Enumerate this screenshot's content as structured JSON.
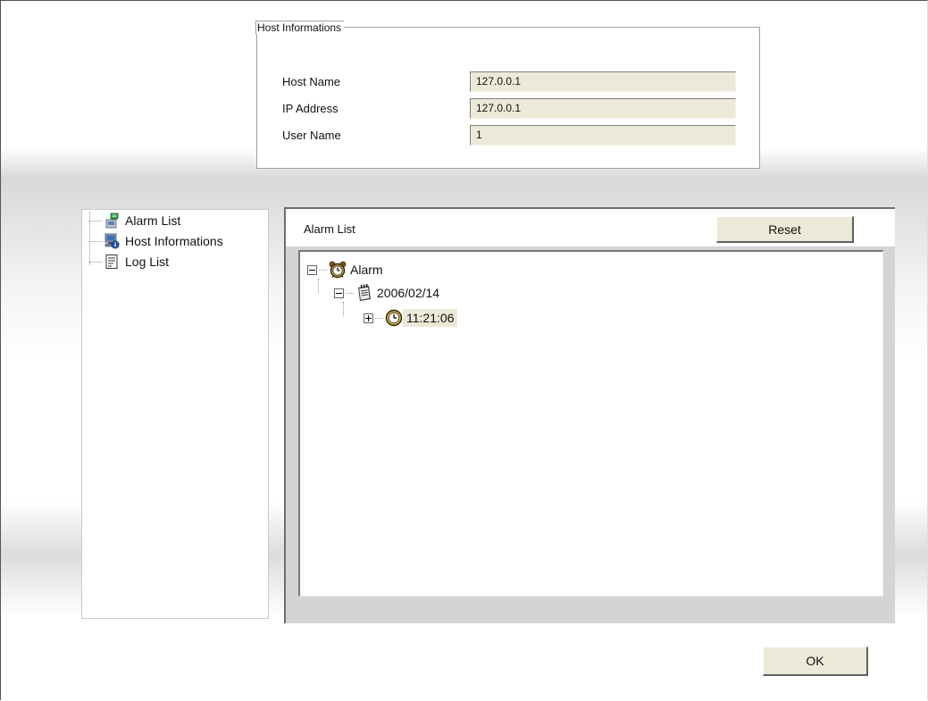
{
  "host_info": {
    "legend": "Host Informations",
    "rows": [
      {
        "label": "Host Name",
        "value": "127.0.0.1"
      },
      {
        "label": "IP Address",
        "value": "127.0.0.1"
      },
      {
        "label": "User Name",
        "value": "1"
      }
    ]
  },
  "nav": {
    "items": [
      {
        "label": "Alarm List",
        "icon": "alarm-list-icon"
      },
      {
        "label": "Host Informations",
        "icon": "host-info-icon"
      },
      {
        "label": "Log List",
        "icon": "log-list-icon"
      }
    ]
  },
  "panel": {
    "title": "Alarm List",
    "reset_label": "Reset",
    "tree": {
      "root": {
        "label": "Alarm",
        "icon": "alarm-clock-icon",
        "expanded": true
      },
      "date": {
        "label": "2006/02/14",
        "icon": "notepad-icon",
        "expanded": true
      },
      "time": {
        "label": "11:21:06",
        "icon": "clock-icon",
        "expanded": false,
        "selected": true
      }
    }
  },
  "ok_label": "OK",
  "colors": {
    "field_bg": "#ece9d8",
    "panel_bg": "#d4d4d4"
  }
}
